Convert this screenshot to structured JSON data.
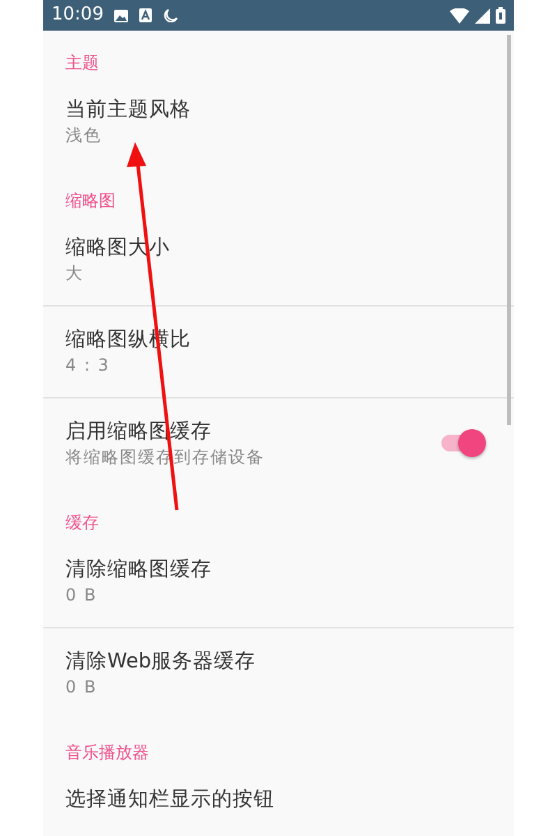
{
  "status_bar": {
    "time": "10:09"
  },
  "sections": [
    {
      "title": "主题",
      "items": [
        {
          "kind": "text",
          "title": "当前主题风格",
          "summary": "浅色"
        }
      ]
    },
    {
      "title": "缩略图",
      "items": [
        {
          "kind": "text",
          "title": "缩略图大小",
          "summary": "大"
        },
        {
          "kind": "text",
          "title": "缩略图纵横比",
          "summary": "4 : 3"
        },
        {
          "kind": "switch",
          "title": "启用缩略图缓存",
          "summary": "将缩略图缓存到存储设备",
          "on": true
        }
      ]
    },
    {
      "title": "缓存",
      "items": [
        {
          "kind": "text",
          "title": "清除缩略图缓存",
          "summary": "0 B"
        },
        {
          "kind": "text",
          "title": "清除Web服务器缓存",
          "summary": "0 B"
        }
      ]
    },
    {
      "title": "音乐播放器",
      "items": [
        {
          "kind": "text",
          "title": "选择通知栏显示的按钮"
        }
      ]
    }
  ]
}
